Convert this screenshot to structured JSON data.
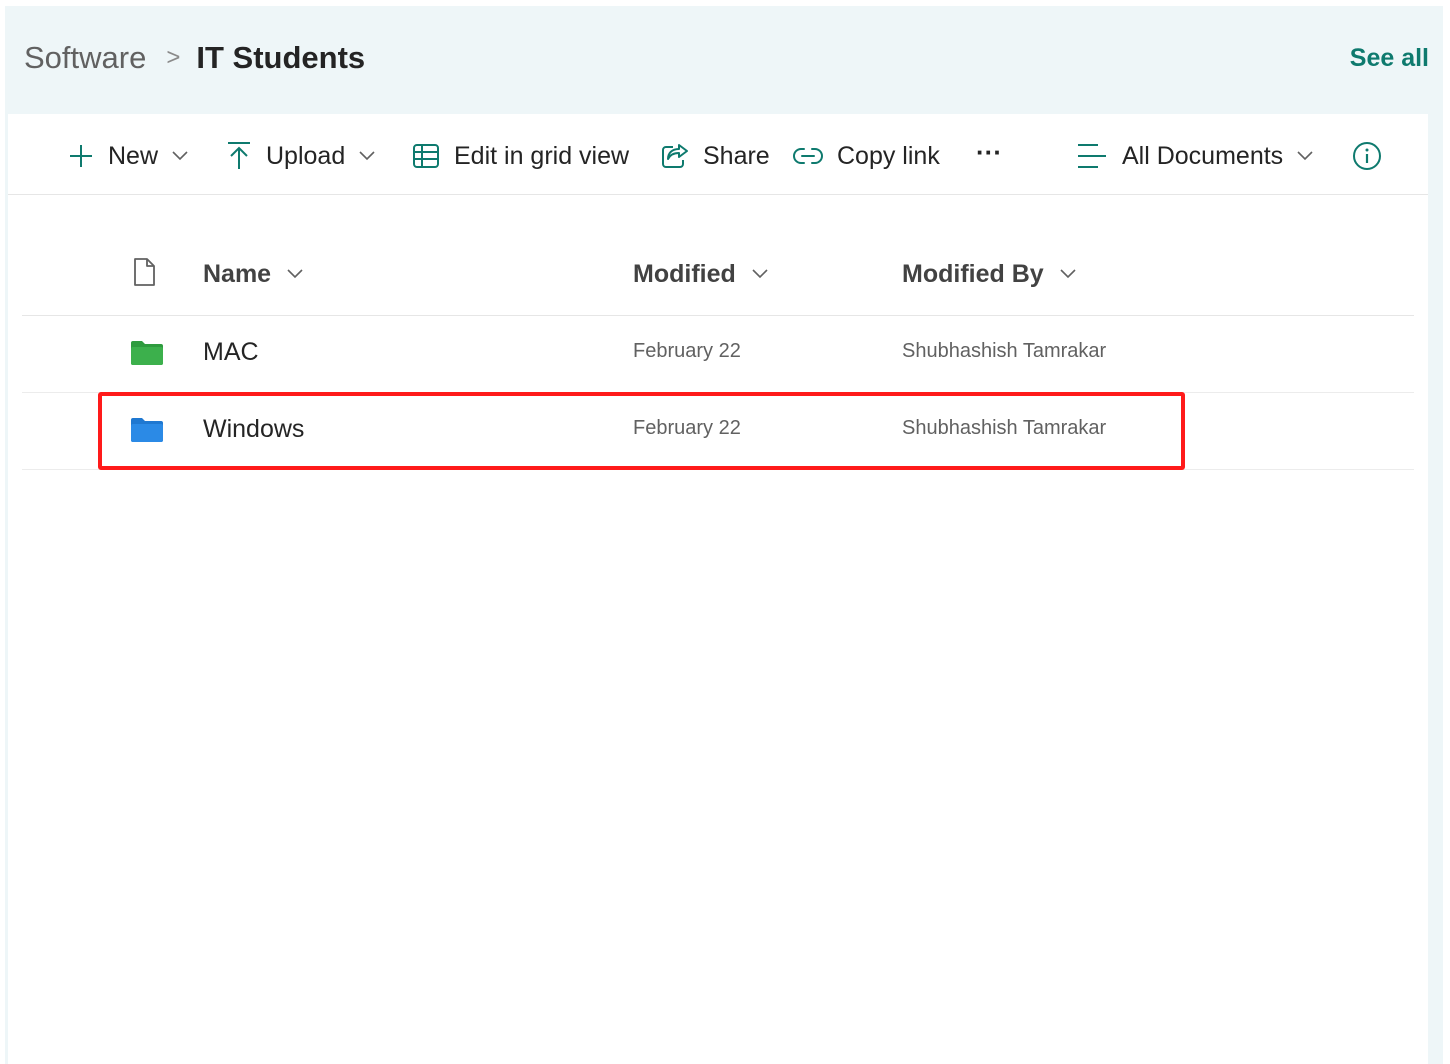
{
  "breadcrumb": {
    "parent": "Software",
    "separator": ">",
    "current": "IT Students"
  },
  "header": {
    "see_all": "See all"
  },
  "toolbar": {
    "new": "New",
    "upload": "Upload",
    "edit_grid": "Edit in grid view",
    "share": "Share",
    "copy_link": "Copy link",
    "more": "···",
    "view": "All Documents"
  },
  "columns": {
    "name": "Name",
    "modified": "Modified",
    "modified_by": "Modified By"
  },
  "rows": [
    {
      "name": "MAC",
      "modified": "February 22",
      "modified_by": "Shubhashish Tamrakar",
      "folder_color": "#2e9b3e"
    },
    {
      "name": "Windows",
      "modified": "February 22",
      "modified_by": "Shubhashish Tamrakar",
      "folder_color": "#1f78d1"
    }
  ],
  "colors": {
    "accent": "#0e7a6e",
    "highlight": "#ff1a1a",
    "header_bg": "#eef6f8"
  },
  "icons": [
    "plus-icon",
    "upload-icon",
    "grid-icon",
    "share-icon",
    "link-icon",
    "more-icon",
    "list-view-icon",
    "info-icon",
    "document-icon",
    "folder-icon",
    "chevron-down-icon"
  ]
}
